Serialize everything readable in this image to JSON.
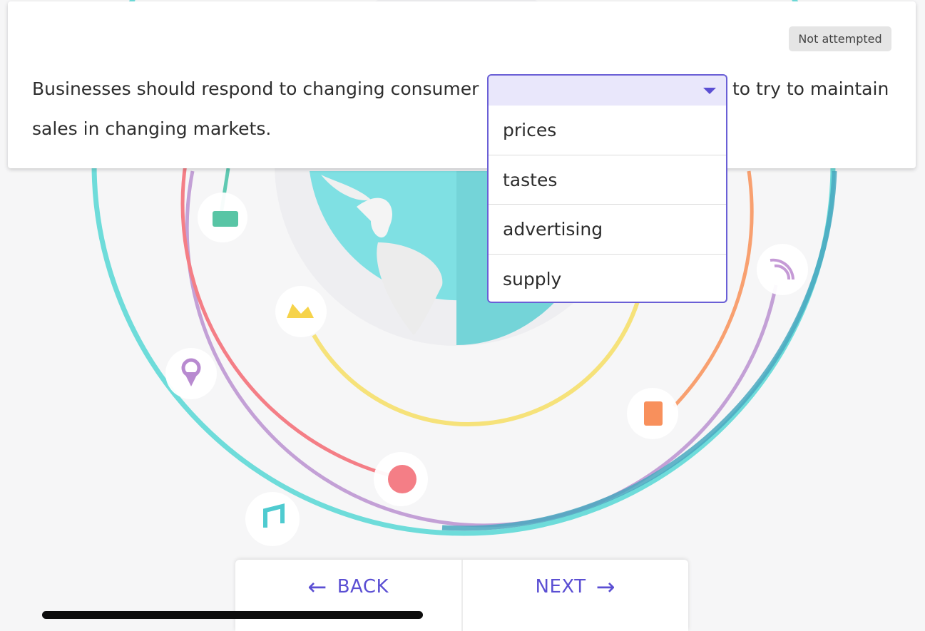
{
  "status": {
    "label": "Not attempted"
  },
  "question": {
    "line1_before": "Businesses should respond to changing consumer",
    "line1_after": "to try to maintain",
    "line2": "sales in changing markets."
  },
  "dropdown": {
    "selected": "",
    "options": [
      "prices",
      "tastes",
      "advertising",
      "supply"
    ]
  },
  "navigation": {
    "back_label": "BACK",
    "next_label": "NEXT",
    "back_arrow": "←",
    "next_arrow": "→"
  },
  "colors": {
    "accent": "#5b4fd3",
    "select_bg": "#e9e7fb",
    "ring_teal": "#5fd9d6",
    "ring_purple": "#c3a0d6",
    "ring_pink": "#f47e86",
    "ring_yellow": "#f6e27a",
    "ring_orange": "#f8a070",
    "ring_blue": "#4aa8c0"
  }
}
